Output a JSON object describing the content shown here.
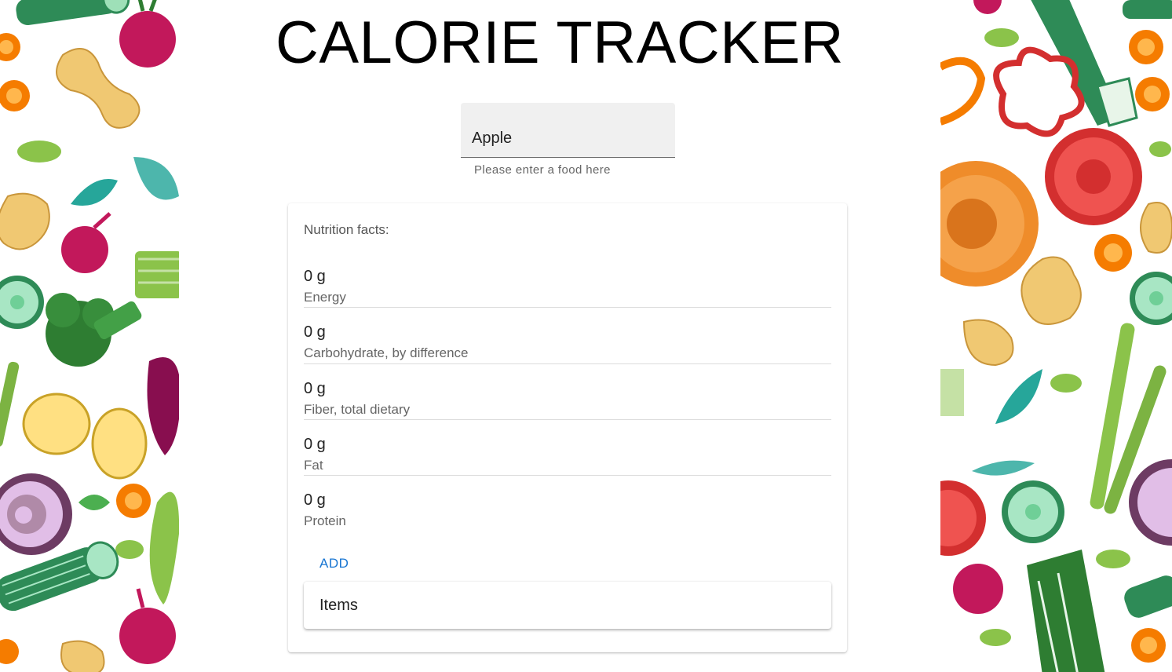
{
  "app": {
    "title": "CALORIE TRACKER"
  },
  "search": {
    "value": "Apple",
    "helper_text": "Please enter a food here"
  },
  "nutrition": {
    "label": "Nutrition facts:",
    "items": [
      {
        "value": "0 g",
        "name": "Energy"
      },
      {
        "value": "0 g",
        "name": "Carbohydrate, by difference"
      },
      {
        "value": "0 g",
        "name": "Fiber, total dietary"
      },
      {
        "value": "0 g",
        "name": "Fat"
      },
      {
        "value": "0 g",
        "name": "Protein"
      }
    ],
    "add_label": "ADD"
  },
  "items_panel": {
    "label": "Items"
  },
  "colors": {
    "accent": "#1976d2",
    "field_bg": "#f0f0f0"
  },
  "background": {
    "left_panel_icons": [
      "cucumber-icon",
      "beet-icon",
      "carrot-slice-icon",
      "ginger-icon",
      "bean-icon",
      "leaf-icon",
      "broccoli-icon",
      "potato-icon",
      "onion-icon",
      "celery-icon",
      "asparagus-icon"
    ],
    "right_panel_icons": [
      "leek-icon",
      "pepper-ring-icon",
      "tomato-icon",
      "pumpkin-icon",
      "ginger-icon",
      "cucumber-slice-icon",
      "asparagus-icon",
      "arugula-icon",
      "beet-icon",
      "onion-icon"
    ]
  }
}
